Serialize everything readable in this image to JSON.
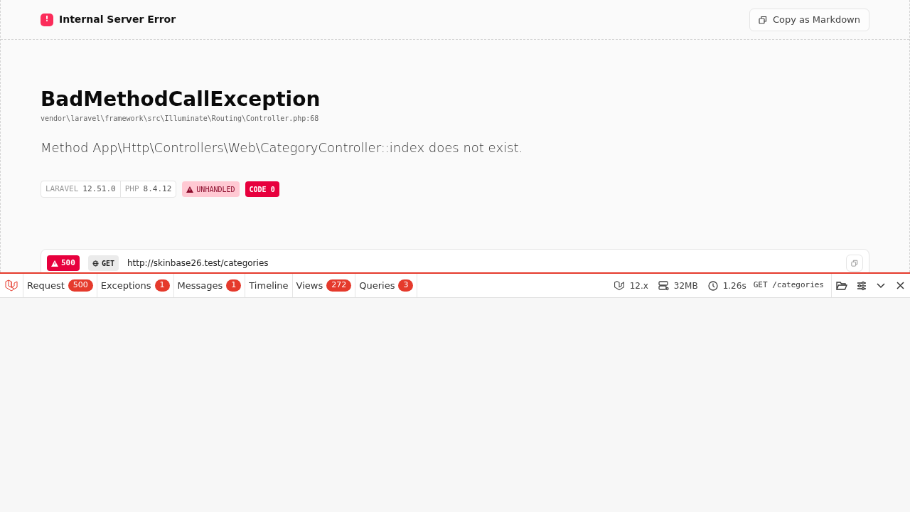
{
  "header": {
    "title": "Internal Server Error",
    "icon_text": "!",
    "copy_button": "Copy as Markdown"
  },
  "exception": {
    "class": "BadMethodCallException",
    "location": "vendor\\laravel\\framework\\src\\Illuminate\\Routing\\Controller.php:68",
    "message": "Method App\\Http\\Controllers\\Web\\CategoryController::index does not exist."
  },
  "versions": [
    {
      "label": "LARAVEL",
      "value": "12.51.0"
    },
    {
      "label": "PHP",
      "value": "8.4.12"
    }
  ],
  "badges": [
    {
      "kind": "unhandled",
      "text": "UNHANDLED"
    },
    {
      "kind": "code",
      "text": "CODE 0"
    }
  ],
  "request": {
    "status": "500",
    "method": "GET",
    "url": "http://skinbase26.test/categories"
  },
  "debugbar": {
    "tabs": [
      {
        "label": "Request",
        "count": "500"
      },
      {
        "label": "Exceptions",
        "count": "1"
      },
      {
        "label": "Messages",
        "count": "1"
      },
      {
        "label": "Timeline"
      },
      {
        "label": "Views",
        "count": "272"
      },
      {
        "label": "Queries",
        "count": "3"
      }
    ],
    "stats": [
      {
        "kind": "version",
        "text": "12.x"
      },
      {
        "kind": "memory",
        "text": "32MB"
      },
      {
        "kind": "time",
        "text": "1.26s"
      }
    ],
    "route": "GET /categories"
  }
}
